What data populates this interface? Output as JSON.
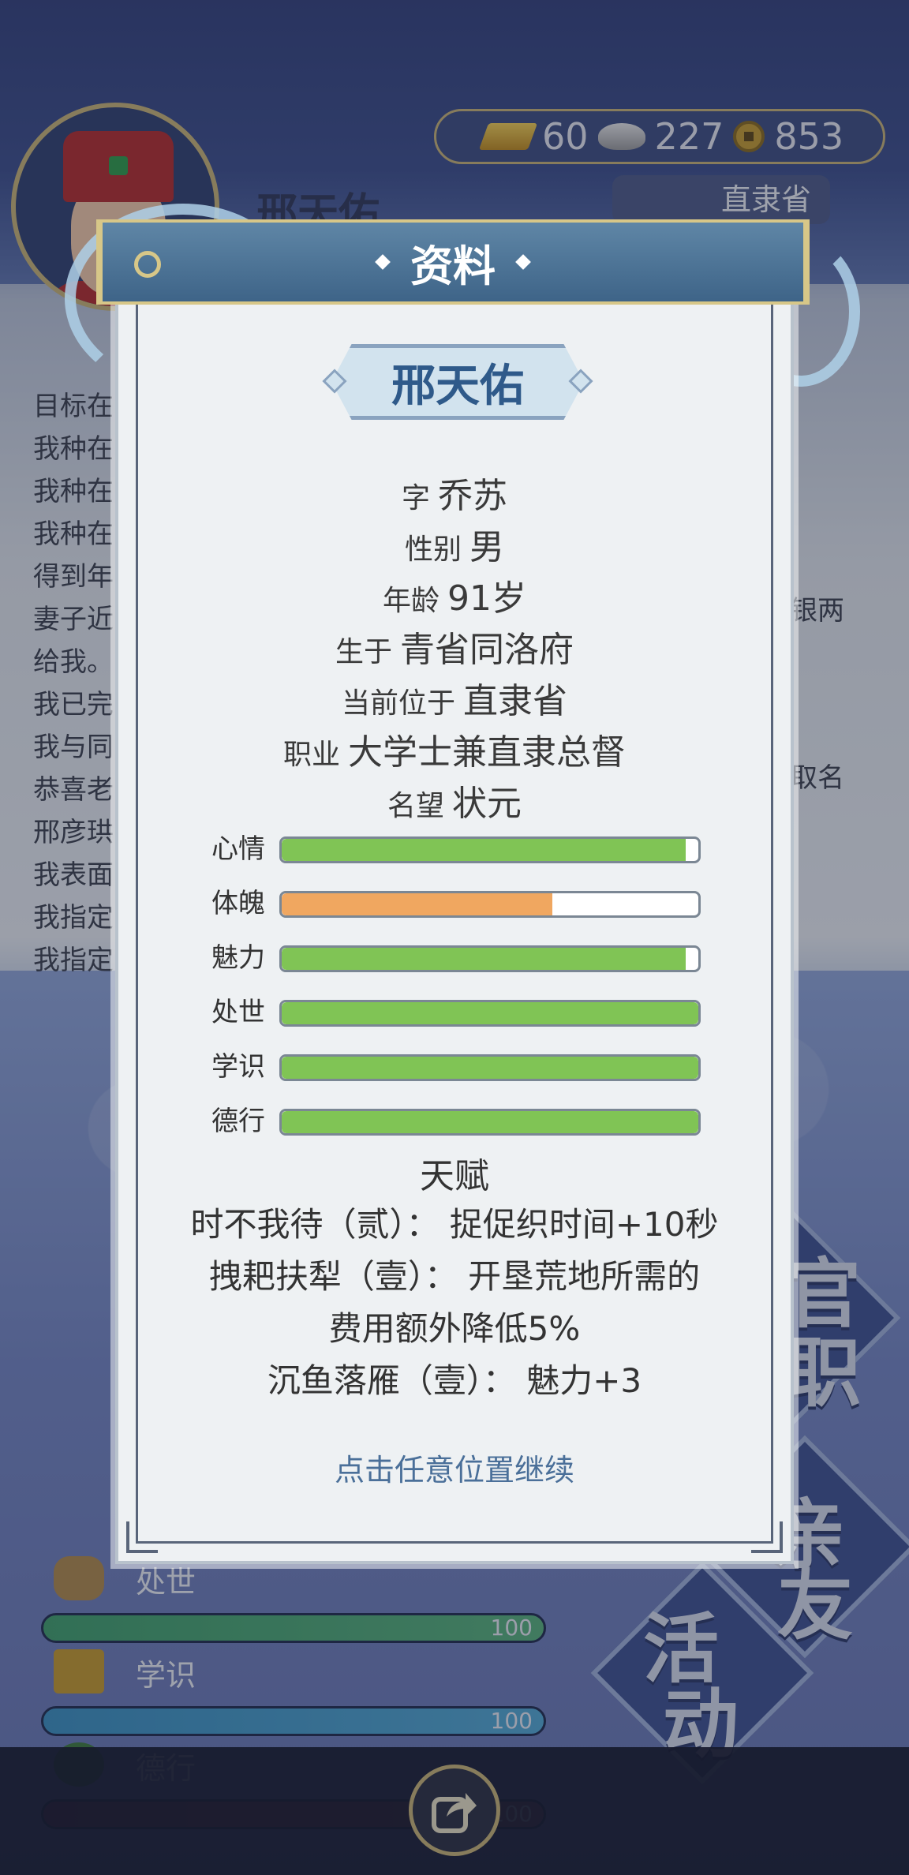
{
  "background": {
    "currency": {
      "gold": "60",
      "silver": "227",
      "coins": "853"
    },
    "region": "直隶省",
    "name": "邢天佑",
    "story_lines": [
      "目标在",
      "我种在",
      "我种在",
      "我种在",
      "得到年",
      "妻子近",
      "给我。",
      "我已完",
      "我与同",
      "恭喜老",
      "邢彦珙",
      "我表面",
      "我指定",
      "我指定"
    ],
    "story_right": {
      "line5": "银两",
      "line9": "取名"
    },
    "side_buttons": [
      {
        "chars": [
          "官",
          "职"
        ]
      },
      {
        "chars": [
          "亲",
          "友"
        ]
      },
      {
        "chars": [
          "活",
          "动"
        ]
      }
    ],
    "stats": [
      {
        "label": "处世",
        "value": "100"
      },
      {
        "label": "学识",
        "value": "100"
      },
      {
        "label": "德行",
        "value": "100"
      }
    ]
  },
  "dialog": {
    "title": "资料",
    "name": "邢天佑",
    "info": [
      {
        "key": "字",
        "value": "乔苏"
      },
      {
        "key": "性别",
        "value": "男"
      },
      {
        "key": "年龄",
        "value": "91岁"
      },
      {
        "key": "生于",
        "value": "青省同洛府"
      },
      {
        "key": "当前位于",
        "value": "直隶省"
      },
      {
        "key": "职业",
        "value": "大学士兼直隶总督"
      },
      {
        "key": "名望",
        "value": "状元"
      }
    ],
    "attributes": [
      {
        "label": "心情",
        "level": 0.97,
        "color": "#80c455"
      },
      {
        "label": "体魄",
        "level": 0.65,
        "color": "#f0a760"
      },
      {
        "label": "魅力",
        "level": 0.97,
        "color": "#80c455"
      },
      {
        "label": "处世",
        "level": 1.0,
        "color": "#80c455"
      },
      {
        "label": "学识",
        "level": 1.0,
        "color": "#80c455"
      },
      {
        "label": "德行",
        "level": 1.0,
        "color": "#80c455"
      }
    ],
    "talent_title": "天赋",
    "talents": [
      "时不我待（贰）： 捉促织时间+10秒",
      "拽耙扶犁（壹）： 开垦荒地所需的",
      "费用额外降低5%",
      "沉鱼落雁（壹）： 魅力+3"
    ],
    "continue_hint": "点击任意位置继续"
  }
}
